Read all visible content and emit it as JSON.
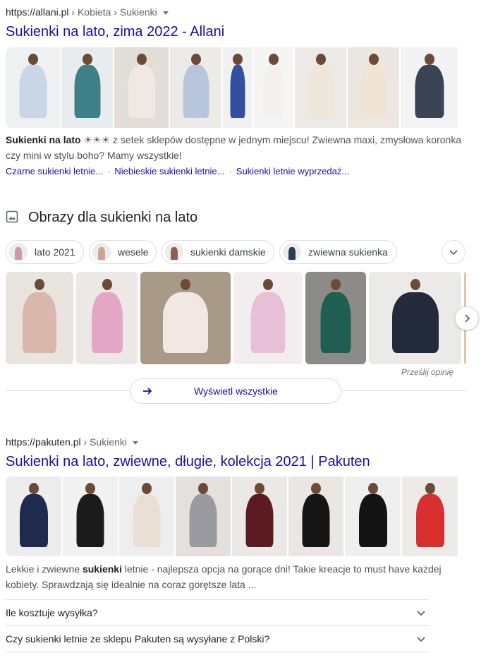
{
  "result1": {
    "url": "https://allani.pl",
    "breadcrumb": " › Kobieta › Sukienki",
    "title": "Sukienki na lato, zima 2022 - Allani",
    "snippet_bold": "Sukienki na lato",
    "snippet_stars": " ☀☀☀ ",
    "snippet_rest": "z setek sklepów dostępne w jednym miejscu! Zwiewna maxi, zmysłowa koronka czy mini w stylu boho? Mamy wszystkie!",
    "sitelinks": [
      "Czarne sukienki letnie...",
      "Niebieskie sukienki letnie...",
      "Sukienki letnie wyprzedaż..."
    ],
    "thumbs": [
      {
        "bg": "#eef0f2",
        "dress": "#c9d6e6"
      },
      {
        "bg": "#e9ecee",
        "dress": "#3f7f88"
      },
      {
        "bg": "#e2ddd6",
        "dress": "#efe9e2"
      },
      {
        "bg": "#ecebe8",
        "dress": "#b7c6dc"
      },
      {
        "bg": "#f1f1f1",
        "dress": "#3350a0"
      },
      {
        "bg": "#f5f5f5",
        "dress": "#f3f1ee"
      },
      {
        "bg": "#eceae6",
        "dress": "#efe6dc"
      },
      {
        "bg": "#ece7e0",
        "dress": "#f0e4d4"
      },
      {
        "bg": "#f3f3f3",
        "dress": "#394455"
      }
    ]
  },
  "images": {
    "heading": "Obrazy dla sukienki na lato",
    "chips": [
      {
        "label": "lato 2021",
        "color": "#c99aa7"
      },
      {
        "label": "wesele",
        "color": "#caa593"
      },
      {
        "label": "sukienki damskie",
        "color": "#8f5d52"
      },
      {
        "label": "zwiewna sukienka",
        "color": "#2c3b55"
      }
    ],
    "photos": [
      {
        "bg": "#e9e4de",
        "dress": "#d9b7ad"
      },
      {
        "bg": "#ece8e6",
        "dress": "#e3a7c5"
      },
      {
        "bg": "#a89a86",
        "dress": "#f1e7e3"
      },
      {
        "bg": "#f2eef0",
        "dress": "#e7bfd6"
      },
      {
        "bg": "#8d8b88",
        "dress": "#1f5f52"
      },
      {
        "bg": "#eceae8",
        "dress": "#232a3b"
      }
    ],
    "feedback": "Prześlij opinię",
    "view_all": "Wyświetl wszystkie"
  },
  "result2": {
    "url": "https://pakuten.pl",
    "breadcrumb": " › Sukienki",
    "title": "Sukienki na lato, zwiewne, długie, kolekcja 2021 | Pakuten",
    "snippet_a": "Lekkie i zwiewne ",
    "snippet_bold": "sukienki",
    "snippet_b": " letnie - najlepsza opcja na gorące dni! Takie kreacje to must have każdej kobiety. Sprawdzają się idealnie na coraz gorętsze lata ...",
    "thumbs": [
      {
        "bg": "#ededed",
        "dress": "#1e2b4f"
      },
      {
        "bg": "#f1f1f1",
        "dress": "#1b1b1b"
      },
      {
        "bg": "#eeeeee",
        "dress": "#eadfd3"
      },
      {
        "bg": "#e4e1dd",
        "dress": "#9a9ba0"
      },
      {
        "bg": "#ebe9e7",
        "dress": "#5b1b20"
      },
      {
        "bg": "#e9e6e3",
        "dress": "#151515"
      },
      {
        "bg": "#efefef",
        "dress": "#141414"
      },
      {
        "bg": "#ecebea",
        "dress": "#d8302f"
      }
    ],
    "faq": [
      "Ile kosztuje wysyłka?",
      "Czy sukienki letnie ze sklepu Pakuten są wysyłane z Polski?"
    ]
  }
}
